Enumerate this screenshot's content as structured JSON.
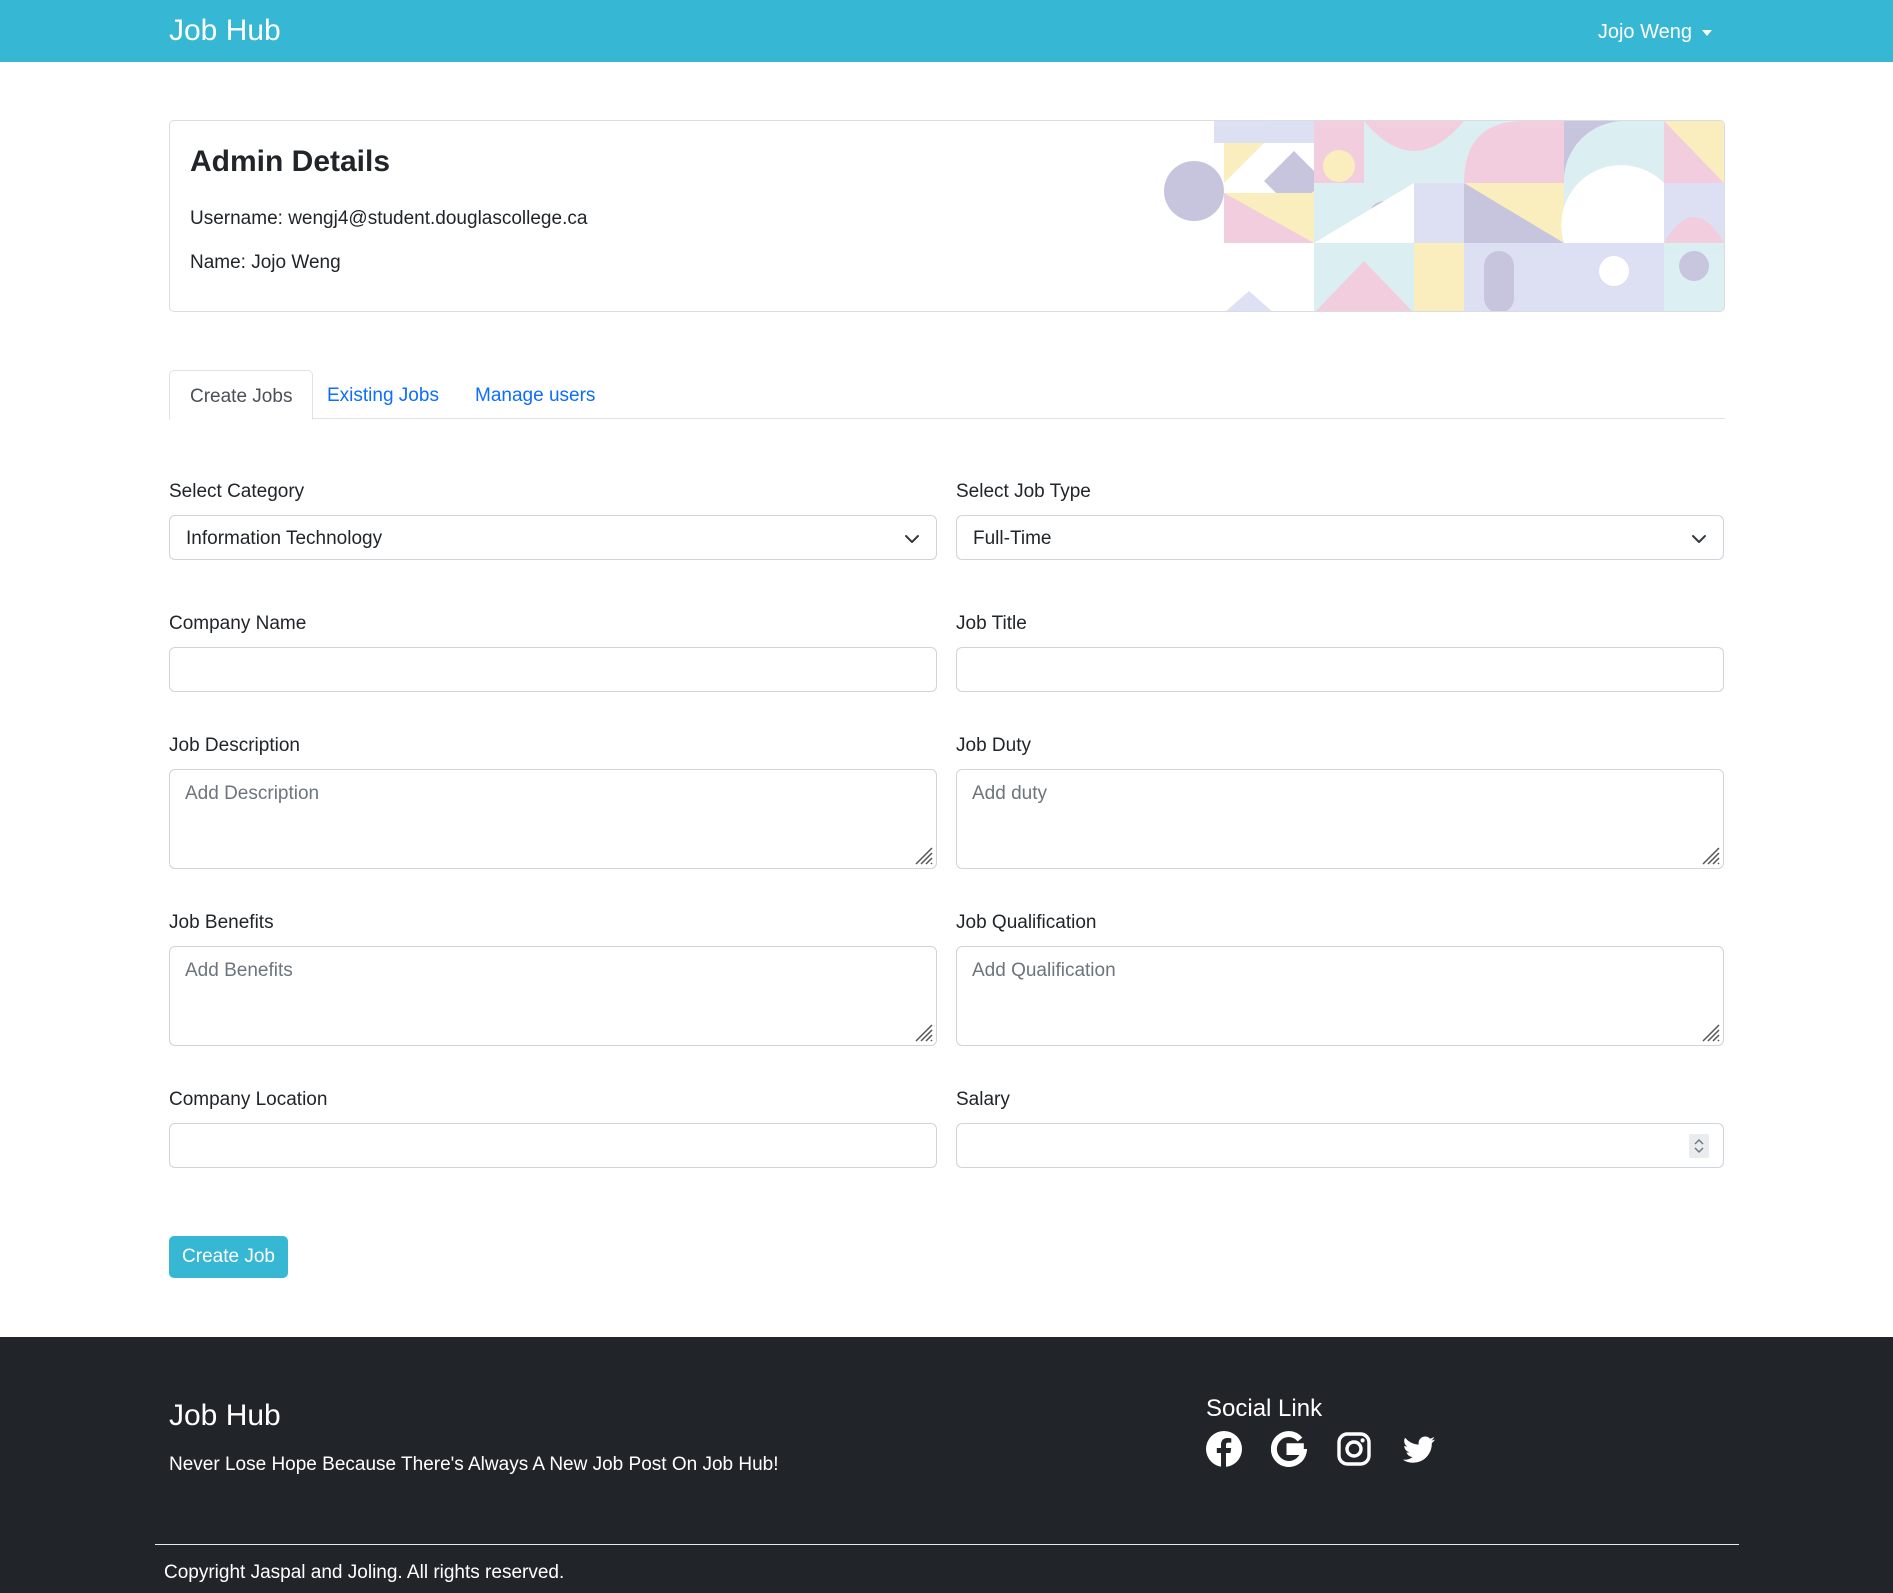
{
  "navbar": {
    "brand": "Job Hub",
    "user_name": "Jojo Weng"
  },
  "admin": {
    "title": "Admin Details",
    "username": "Username: wengj4@student.douglascollege.ca",
    "name": "Name: Jojo Weng"
  },
  "tabs": [
    {
      "label": "Create Jobs",
      "active": true
    },
    {
      "label": "Existing Jobs",
      "active": false
    },
    {
      "label": "Manage users",
      "active": false
    }
  ],
  "form": {
    "category": {
      "label": "Select Category",
      "value": "Information Technology"
    },
    "job_type": {
      "label": "Select Job Type",
      "value": "Full-Time"
    },
    "company_name": {
      "label": "Company Name",
      "value": ""
    },
    "job_title": {
      "label": "Job Title",
      "value": ""
    },
    "job_description": {
      "label": "Job Description",
      "placeholder": "Add Description"
    },
    "job_duty": {
      "label": "Job Duty",
      "placeholder": "Add duty"
    },
    "job_benefits": {
      "label": "Job Benefits",
      "placeholder": "Add Benefits"
    },
    "job_qualification": {
      "label": "Job Qualification",
      "placeholder": "Add Qualification"
    },
    "company_location": {
      "label": "Company Location",
      "value": ""
    },
    "salary": {
      "label": "Salary",
      "value": ""
    },
    "submit_label": "Create Job"
  },
  "footer": {
    "brand": "Job Hub",
    "tagline": "Never Lose Hope Because There's Always A New Job Post On Job Hub!",
    "social_heading": "Social Link",
    "social_icons": [
      "facebook-icon",
      "google-icon",
      "instagram-icon",
      "twitter-icon"
    ],
    "copyright": "Copyright Jaspal and Joling. All rights reserved."
  },
  "colors": {
    "primary": "#36b7d4",
    "link": "#0d6efd",
    "footer_bg": "#212529"
  }
}
